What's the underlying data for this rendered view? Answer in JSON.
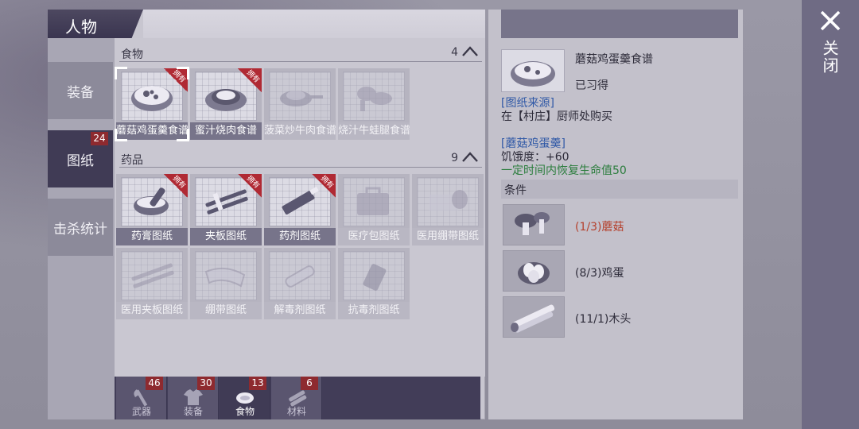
{
  "header": {
    "title": "人物"
  },
  "sidebar": {
    "items": [
      {
        "label": "装备"
      },
      {
        "label": "图纸",
        "badge": "24"
      },
      {
        "label": "击杀统计"
      }
    ]
  },
  "sections": [
    {
      "label": "食物",
      "count": "4",
      "cards": [
        {
          "name": "蘑菇鸡蛋羹食谱",
          "owned": "拥有",
          "icon": "bowl-soup-icon"
        },
        {
          "name": "蜜汁烧肉食谱",
          "owned": "拥有",
          "icon": "plate-meat-icon"
        },
        {
          "name": "菠菜炒牛肉食谱",
          "icon": "pan-icon"
        },
        {
          "name": "烧汁牛蛙腿食谱",
          "icon": "frog-leg-icon"
        }
      ]
    },
    {
      "label": "药品",
      "count": "9",
      "cards": [
        {
          "name": "药膏图纸",
          "owned": "拥有",
          "icon": "mortar-icon"
        },
        {
          "name": "夹板图纸",
          "owned": "拥有",
          "icon": "splint-icon"
        },
        {
          "name": "药剂图纸",
          "owned": "拥有",
          "icon": "syringe-icon"
        },
        {
          "name": "医疗包图纸",
          "icon": "medkit-icon"
        },
        {
          "name": "医用绷带图纸",
          "icon": "bandage-roll-icon"
        },
        {
          "name": "医用夹板图纸",
          "icon": "splint-icon"
        },
        {
          "name": "绷带图纸",
          "icon": "bandage-icon"
        },
        {
          "name": "解毒剂图纸",
          "icon": "vial-icon"
        },
        {
          "name": "抗毒剂图纸",
          "icon": "pill-bottle-icon"
        }
      ]
    }
  ],
  "bottom_tabs": [
    {
      "label": "武器",
      "badge": "46",
      "icon": "axe-icon"
    },
    {
      "label": "装备",
      "badge": "30",
      "icon": "shirt-icon"
    },
    {
      "label": "食物",
      "badge": "13",
      "icon": "meat-icon"
    },
    {
      "label": "材料",
      "badge": "6",
      "icon": "logs-icon"
    }
  ],
  "detail": {
    "name": "蘑菇鸡蛋羹食谱",
    "status": "已习得",
    "source_title": "[图纸来源]",
    "source_text": "在【村庄】厨师处购买",
    "item_title": "[蘑菇鸡蛋羹]",
    "effect1": "饥饿度：+60",
    "effect2": "一定时间内恢复生命值50",
    "condition_header": "条件",
    "materials": [
      {
        "text": "(1/3)蘑菇",
        "status": "insufficient",
        "icon": "mushroom-icon"
      },
      {
        "text": "(8/3)鸡蛋",
        "status": "ok",
        "icon": "eggs-icon"
      },
      {
        "text": "(11/1)木头",
        "status": "ok",
        "icon": "wood-icon"
      }
    ]
  },
  "close_label": "关闭",
  "colors": {
    "accent": "#403b55",
    "owned_ribbon": "#b02a34",
    "insufficient": "#b5402c",
    "link_blue": "#2f58a6",
    "effect_green": "#2b7d3d"
  }
}
